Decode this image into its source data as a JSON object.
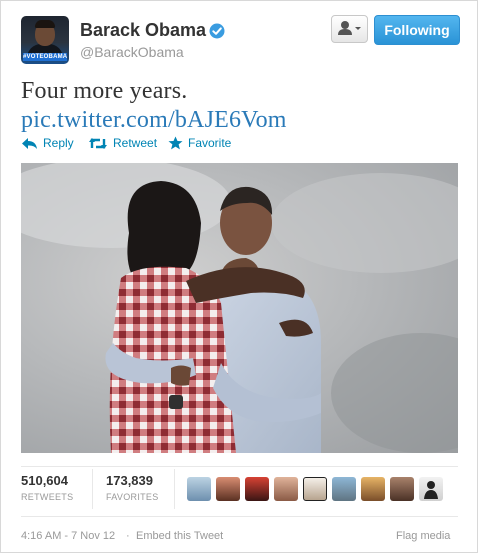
{
  "user": {
    "name": "Barack Obama",
    "handle": "@BarackObama",
    "avatar_tag": "#VOTEOBAMA",
    "verified": true
  },
  "buttons": {
    "user_actions_icon": "person-dropdown-icon",
    "follow_label": "Following"
  },
  "tweet": {
    "text": "Four more years.",
    "link": "pic.twitter.com/bAJE6Vom"
  },
  "actions": [
    {
      "label": "Reply",
      "icon": "reply-icon"
    },
    {
      "label": "Retweet",
      "icon": "retweet-icon"
    },
    {
      "label": "Favorite",
      "icon": "star-icon"
    }
  ],
  "stats": {
    "retweets": {
      "value": "510,604",
      "label": "RETWEETS"
    },
    "favorites": {
      "value": "173,839",
      "label": "FAVORITES"
    }
  },
  "footer": {
    "timestamp": "4:16 AM - 7 Nov 12",
    "separator": "·",
    "embed": "Embed this Tweet",
    "flag": "Flag media"
  },
  "colors": {
    "link": "#0084b4",
    "follow_button": "#2a93d6",
    "verified": "#3a9ce0"
  }
}
